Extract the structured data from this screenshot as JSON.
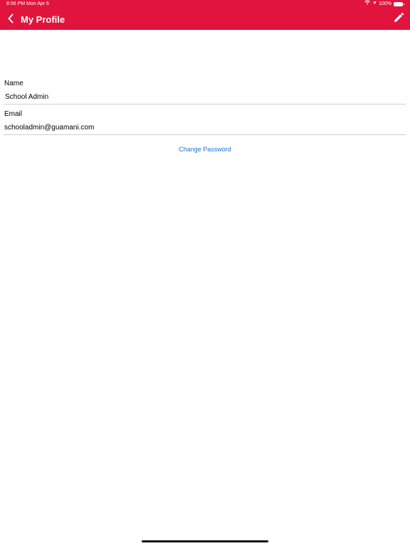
{
  "status_bar": {
    "time": "8:56 PM",
    "date": "Mon Apr 6",
    "battery": "100%"
  },
  "header": {
    "title": "My Profile",
    "background_color": "#e0143c",
    "back_icon": "chevron-left-icon",
    "edit_icon": "pencil-icon"
  },
  "profile": {
    "name_label": "Name",
    "name_value": "School Admin",
    "email_label": "Email",
    "email_value": "schooladmin@guamani.com"
  },
  "actions": {
    "change_password": "Change Password",
    "link_color": "#1a73d9"
  }
}
